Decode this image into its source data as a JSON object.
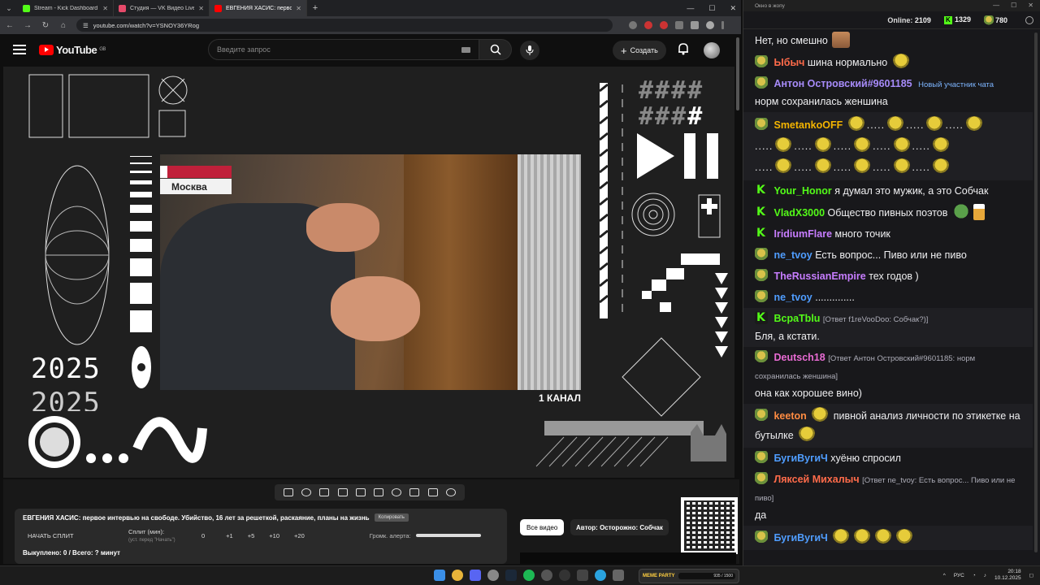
{
  "browser": {
    "tabs": [
      {
        "label": "Stream - Kick Dashboard",
        "color": "#53fc18"
      },
      {
        "label": "Студия — VK Видео Live",
        "color": "#e64a6a"
      },
      {
        "label": "ЕВГЕНИЯ ХАСИС: первое ...",
        "color": "#ff0000"
      }
    ],
    "url": "youtube.com/watch?v=YSNOY36YRog"
  },
  "youtube": {
    "logo": "YouTube",
    "region": "GB",
    "search_placeholder": "Введите запрос",
    "create_label": "Создать"
  },
  "video": {
    "location_caption": "Москва",
    "channel_caption": "1 КАНАЛ",
    "year_1": "2025",
    "year_2": "2025"
  },
  "panel": {
    "title": "ЕВГЕНИЯ ХАСИС: первое интервью на свободе. Убийство, 16 лет за решеткой, раскаяние, планы на жизнь",
    "copy_label": "Копировать",
    "start_split": "НАЧАТЬ СПЛИТ",
    "split_label": "Сплит (мин):",
    "split_hint": "(уст. перед \"Начать\")",
    "split_values": [
      "0",
      "+1",
      "+5",
      "+10",
      "+20"
    ],
    "alert_label": "Громк. алерта:",
    "bought": "Выкуплено: 0 / Всего: ? минут",
    "all_videos": "Все видео",
    "author": "Автор: Осторожно: Собчак"
  },
  "taskbar": {
    "meme_label": "MEME PARTY",
    "meme_progress": "935 / 1500",
    "lang": "РУС",
    "time": "20:18",
    "date": "10.12.2025"
  },
  "chat": {
    "window_title": "Окно в жопу",
    "online_label": "Online:",
    "online_count": "2109",
    "kick_count": "1329",
    "other_count": "780",
    "messages": [
      {
        "user": "",
        "color": "#efeff1",
        "badge": "none",
        "reply": "",
        "text": "Нет, но смешно"
      },
      {
        "user": "Ыбыч",
        "color": "#ff6b4a",
        "badge": "pepe",
        "reply": "",
        "text": "шина нормально"
      },
      {
        "user": "Антон Островский#9601185",
        "color": "#a78bfa",
        "badge": "pepe",
        "reply": "",
        "text": "норм сохранилась женшина",
        "extra": "Новый участник чата"
      },
      {
        "user": "SmetankoOFF",
        "color": "#f4b400",
        "badge": "pepe",
        "reply": "",
        "text": ""
      },
      {
        "user": "Your_Honor",
        "color": "#53fc18",
        "badge": "kick",
        "reply": "",
        "text": "я думал это мужик, а это Собчак"
      },
      {
        "user": "VladX3000",
        "color": "#53fc18",
        "badge": "kick",
        "reply": "",
        "text": "Общество пивных поэтов"
      },
      {
        "user": "IridiumFlare",
        "color": "#c77dff",
        "badge": "kick",
        "reply": "",
        "text": "много точик"
      },
      {
        "user": "ne_tvoy",
        "color": "#4f9dff",
        "badge": "pepe",
        "reply": "",
        "text": "Есть вопрос... Пиво или не пиво"
      },
      {
        "user": "TheRussianEmpire",
        "color": "#c77dff",
        "badge": "pepe",
        "reply": "",
        "text": "тех годов )"
      },
      {
        "user": "ne_tvoy",
        "color": "#4f9dff",
        "badge": "pepe",
        "reply": "",
        "text": ".............."
      },
      {
        "user": "BcpaTblu",
        "color": "#53fc18",
        "badge": "kick",
        "reply": "[Ответ f1reVooDoo: Собчак?)]",
        "text": "Бля, а кстати."
      },
      {
        "user": "Deutsch18",
        "color": "#e86bd3",
        "badge": "pepe",
        "reply": "[Ответ Антон Островский#9601185: норм сохранилась женшина]",
        "text": "она как хорошее вино)"
      },
      {
        "user": "keeton",
        "color": "#ff8c42",
        "badge": "pepe",
        "reply": "",
        "text": "пивной анализ личности по этикетке на бутылке"
      },
      {
        "user": "БугиВугиЧ",
        "color": "#4f9dff",
        "badge": "pepe",
        "reply": "",
        "text": "хуёню спросил"
      },
      {
        "user": "Ляксей Михалыч",
        "color": "#ff6b4a",
        "badge": "pepe",
        "reply": "[Ответ ne_tvoy: Есть вопрос... Пиво или не пиво]",
        "text": "да"
      },
      {
        "user": "БугиВугиЧ",
        "color": "#4f9dff",
        "badge": "pepe",
        "reply": "",
        "text": ""
      }
    ]
  }
}
